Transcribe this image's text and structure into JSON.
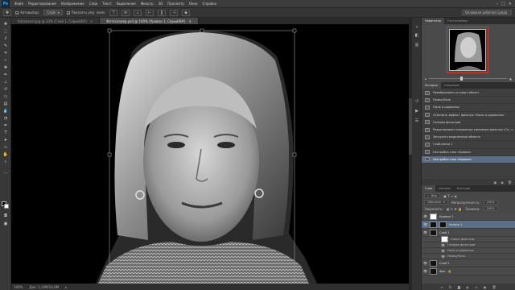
{
  "menubar": {
    "logo": "Ps",
    "items": [
      "Файл",
      "Редактирование",
      "Изображение",
      "Слои",
      "Текст",
      "Выделение",
      "Фильтр",
      "3D",
      "Просмотр",
      "Окно",
      "Справка"
    ],
    "controls": [
      "–",
      "□",
      "×"
    ]
  },
  "options": {
    "autoselect_label": "Автовыбор:",
    "autoselect_value": "Слой",
    "show_controls_label": "Показать упр. элем.",
    "workspace": "Основная рабочая среда"
  },
  "doc_tabs": [
    {
      "title": "fotoskaner.jpg @ 33% (Слой 1, Серый/8#)",
      "active": false
    },
    {
      "title": "Фотосканер.psd @ 100% (Уровни 1, Серый/8#)",
      "active": true
    }
  ],
  "statusbar": {
    "zoom": "100%",
    "doc_info": "Док: 1,14M/14,9M"
  },
  "panels": {
    "navigator_tabs": [
      "Навигатор",
      "Гистограмма"
    ],
    "history_tabs": [
      "История",
      "Операции"
    ],
    "history_items": [
      "Преобразовать в смарт-объект",
      "Палец/Лапа",
      "Пыль и царапины",
      "Отменить эффект фильтра «Пыль и царапины»",
      "Галерея фильтров",
      "Редактировать параметры смешения фильтра «Га...»",
      "Загрузить выделенную область",
      "Слой-маска 1",
      "Настройка слоя «Уровни»",
      "Настройка слоя «Кривые»"
    ],
    "history_selected_index": 9,
    "layers_tabs": [
      "Слои",
      "Каналы",
      "Контуры"
    ],
    "layers_filter": "Вид",
    "blend_mode": "Обычные",
    "opacity_label": "Непрозрачность:",
    "opacity_value": "100%",
    "lock_label": "Закрепить:",
    "fill_label": "Заливка:",
    "fill_value": "100%",
    "layers": [
      {
        "name": "Кривые 1",
        "type": "adjustment",
        "thumb": "white"
      },
      {
        "name": "Уровни 1",
        "type": "adjustment",
        "thumb": "dark"
      },
      {
        "name": "Слой 1",
        "type": "layer",
        "thumb": "dark"
      },
      {
        "name": "Смарт-фильтры",
        "type": "sub",
        "thumb": "white"
      },
      {
        "name": "Галерея фильтров",
        "type": "sub",
        "thumb": ""
      },
      {
        "name": "Пыль и царапины",
        "type": "sub",
        "thumb": ""
      },
      {
        "name": "Палец/Лапа",
        "type": "sub",
        "thumb": ""
      },
      {
        "name": "Слой 2",
        "type": "layer",
        "thumb": "dark"
      },
      {
        "name": "Фон",
        "type": "layer",
        "thumb": "dark"
      }
    ],
    "layers_selected_index": 1
  }
}
